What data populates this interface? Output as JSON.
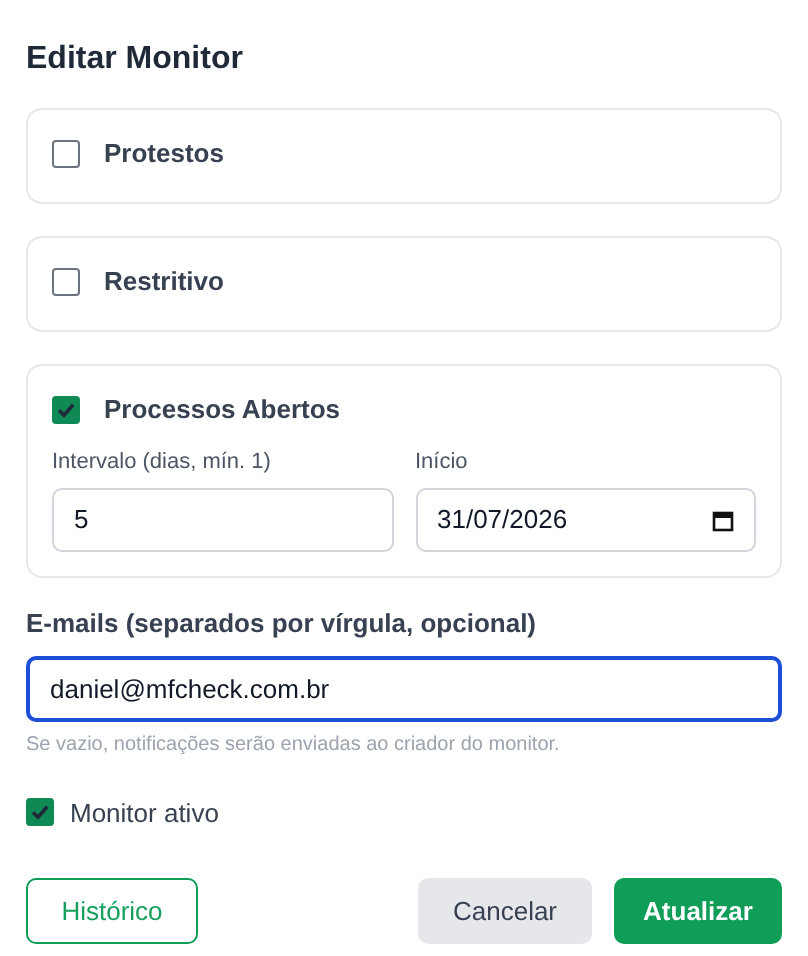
{
  "title": "Editar Monitor",
  "options": [
    {
      "label": "Protestos",
      "checked": false
    },
    {
      "label": "Restritivo",
      "checked": false
    },
    {
      "label": "Processos Abertos",
      "checked": true,
      "fields": [
        {
          "label": "Intervalo (dias, mín. 1)",
          "value": "5",
          "kind": "number"
        },
        {
          "label": "Início",
          "value": "31/07/2026",
          "kind": "date"
        }
      ]
    }
  ],
  "emails": {
    "label": "E-mails (separados por vírgula, opcional)",
    "value": "daniel@mfcheck.com.br",
    "focused": true,
    "hint": "Se vazio, notificações serão enviadas ao criador do monitor."
  },
  "active": {
    "label": "Monitor ativo",
    "checked": true
  },
  "buttons": [
    {
      "label": "Histórico",
      "kind": "outline"
    },
    {
      "label": "Cancelar",
      "kind": "secondary"
    },
    {
      "label": "Atualizar",
      "kind": "primary"
    }
  ]
}
